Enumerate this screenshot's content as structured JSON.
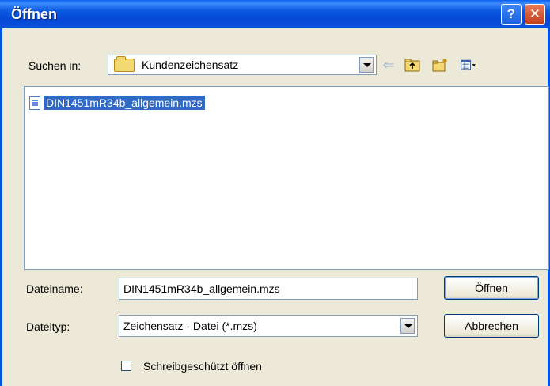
{
  "window": {
    "title": "Öffnen"
  },
  "titlebar": {
    "help_label": "?",
    "close_label": "✕"
  },
  "lookin": {
    "label": "Suchen in:",
    "value": "Kundenzeichensatz"
  },
  "files": [
    {
      "name": "DIN1451mR34b_allgemein.mzs",
      "selected": true
    }
  ],
  "filename": {
    "label": "Dateiname:",
    "value": "DIN1451mR34b_allgemein.mzs"
  },
  "filetype": {
    "label": "Dateityp:",
    "value": "Zeichensatz - Datei (*.mzs)"
  },
  "buttons": {
    "open": "Öffnen",
    "cancel": "Abbrechen"
  },
  "readonly": {
    "label": "Schreibgeschützt öffnen",
    "checked": false
  },
  "icons": [
    "folder-icon",
    "back-arrow-icon",
    "up-folder-icon",
    "new-folder-icon",
    "views-menu-icon",
    "file-icon"
  ],
  "colors": {
    "titlebar": "#0a58e0",
    "selection": "#316ac5",
    "dialog_bg": "#ece9d8"
  }
}
